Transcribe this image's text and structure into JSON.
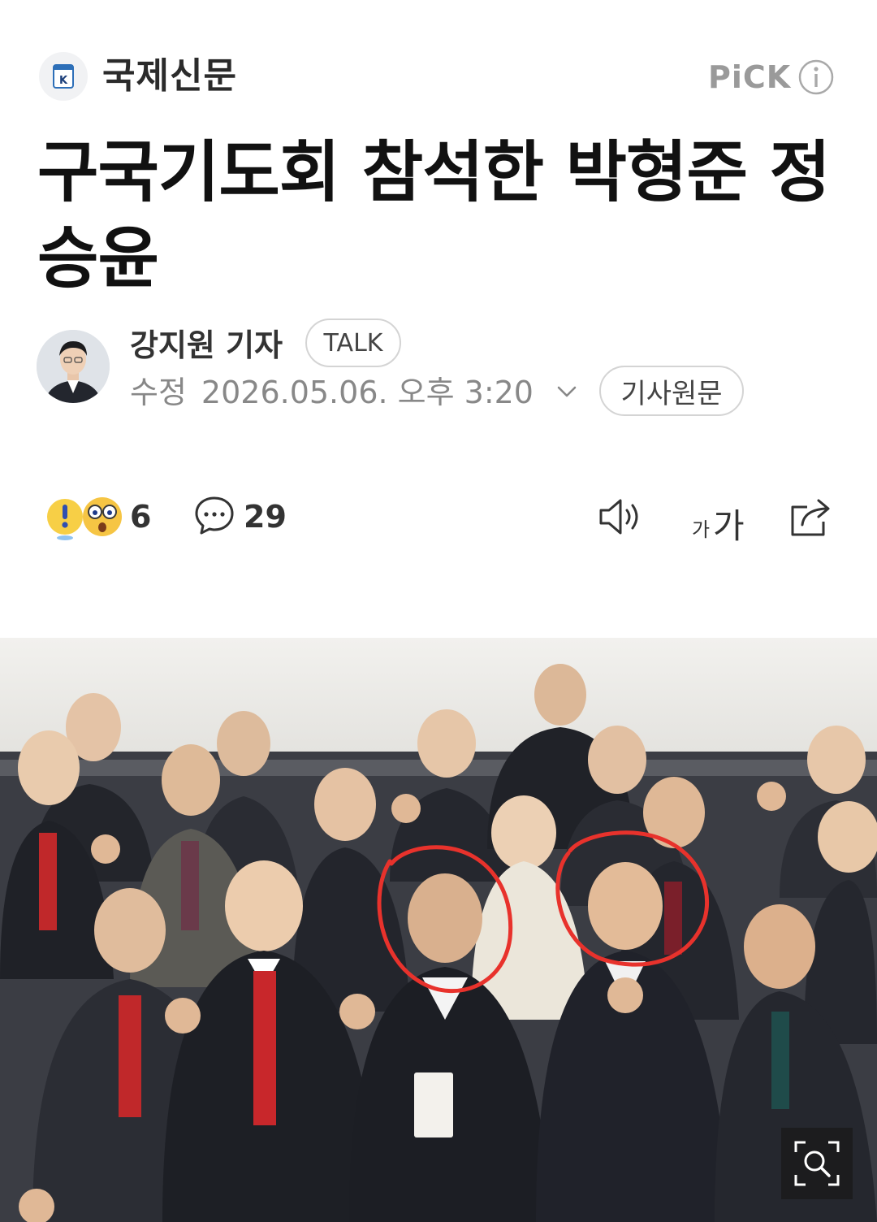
{
  "press": {
    "name": "국제신문",
    "logo_letter": "K",
    "pick_label": "PiCK"
  },
  "article": {
    "headline": "구국기도회 참석한 박형준 정승윤"
  },
  "byline": {
    "reporter": "강지원 기자",
    "talk_label": "TALK",
    "modified_label": "수정",
    "datetime": "2026.05.06. 오후 3:20",
    "original_label": "기사원문"
  },
  "actions": {
    "reaction_count": "6",
    "comment_count": "29",
    "font_small": "가",
    "font_big": "가"
  },
  "icons": [
    "info-icon",
    "chevron-down-icon",
    "reaction-emoji-icon",
    "comment-icon",
    "speaker-icon",
    "share-icon",
    "zoom-icon"
  ],
  "colors": {
    "highlight_circle": "#e8322c",
    "tie_red": "#c0282a",
    "pick_gray": "#9a9a9a"
  }
}
